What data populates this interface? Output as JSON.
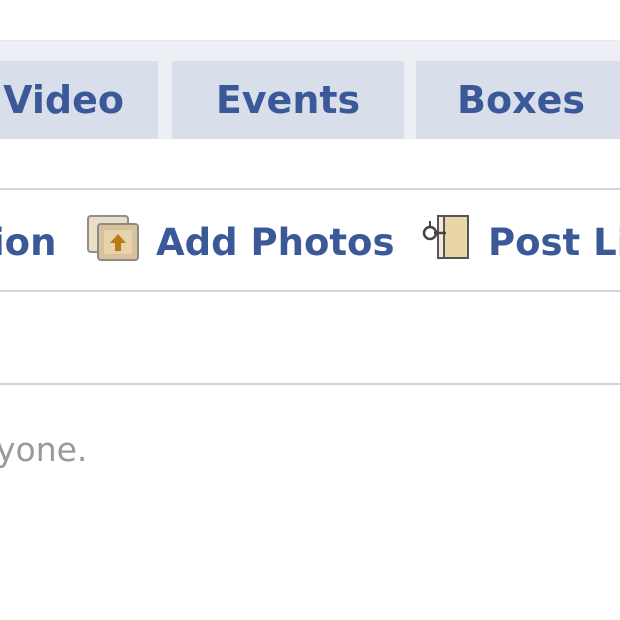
{
  "tabs": [
    {
      "label": "Video"
    },
    {
      "label": "Events"
    },
    {
      "label": "Boxes"
    }
  ],
  "publisher": {
    "items": [
      {
        "label": "ion",
        "icon": "unknown-icon"
      },
      {
        "label": "Add Photos",
        "icon": "photo-icon"
      },
      {
        "label": "Post Li",
        "icon": "link-icon"
      }
    ]
  },
  "privacy_note": "yone.",
  "colors": {
    "link": "#3b5998",
    "tab_bg": "#d8dfea",
    "tab_bar_bg": "#edeff4",
    "muted_text": "#9a9a9a"
  }
}
